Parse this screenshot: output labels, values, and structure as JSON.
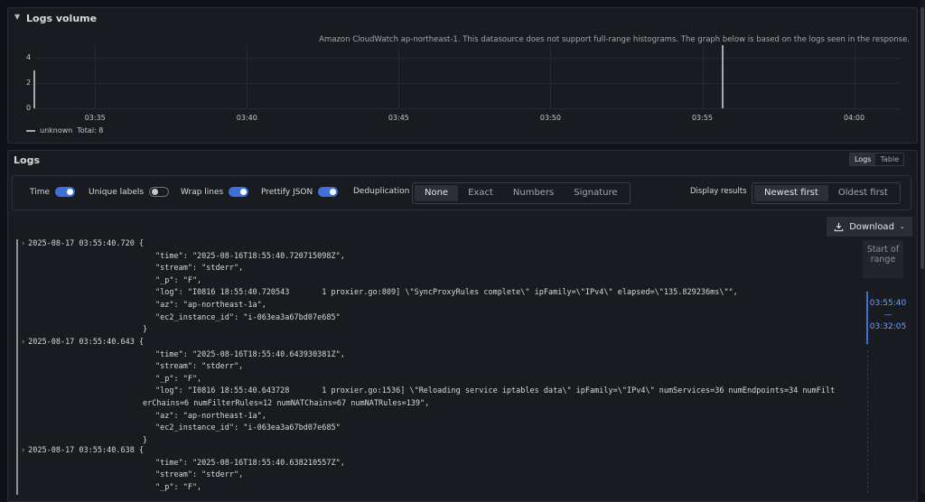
{
  "logs_volume": {
    "title": "Logs volume",
    "info": "Amazon CloudWatch ap-northeast-1. This datasource does not support full-range histograms. The graph below is based on the logs seen in the response.",
    "legend": {
      "series": "unknown",
      "total": "Total: 8"
    }
  },
  "chart_data": {
    "type": "bar",
    "x": [
      "03:33",
      "03:55:40"
    ],
    "values": [
      3,
      5
    ],
    "xticks": [
      "03:35",
      "03:40",
      "03:45",
      "03:50",
      "03:55",
      "04:00"
    ],
    "yticks": [
      "0",
      "2",
      "4"
    ],
    "ylim": [
      0,
      5
    ],
    "series_name": "unknown",
    "grid": true
  },
  "logs": {
    "title": "Logs",
    "view_toggle": [
      "Logs",
      "Table"
    ],
    "options": {
      "time": "Time",
      "unique_labels": "Unique labels",
      "wrap_lines": "Wrap lines",
      "prettify_json": "Prettify JSON",
      "deduplication": "Deduplication",
      "dedup_options": [
        "None",
        "Exact",
        "Numbers",
        "Signature"
      ],
      "display_results": "Display results",
      "order_options": [
        "Newest first",
        "Oldest first"
      ]
    },
    "download": "Download",
    "range": {
      "start": "Start of range",
      "from": "03:55:40",
      "sep": "—",
      "to": "03:32:05"
    },
    "entries": [
      {
        "head": "2025-08-17 03:55:40.720 {",
        "lines": [
          "\"time\": \"2025-08-16T18:55:40.720715098Z\",",
          "\"stream\": \"stderr\",",
          "\"_p\": \"F\",",
          "\"log\": \"I0816 18:55:40.720543       1 proxier.go:809] \\\"SyncProxyRules complete\\\" ipFamily=\\\"IPv4\\\" elapsed=\\\"135.829236ms\\\"\",",
          "\"az\": \"ap-northeast-1a\",",
          "\"ec2_instance_id\": \"i-063ea3a67bd07e685\""
        ],
        "close": "}"
      },
      {
        "head": "2025-08-17 03:55:40.643 {",
        "lines": [
          "\"time\": \"2025-08-16T18:55:40.643930381Z\",",
          "\"stream\": \"stderr\",",
          "\"_p\": \"F\",",
          "\"log\": \"I0816 18:55:40.643728       1 proxier.go:1536] \\\"Reloading service iptables data\\\" ipFamily=\\\"IPv4\\\" numServices=36 numEndpoints=34 numFilt",
          "erChains=6 numFilterRules=12 numNATChains=67 numNATRules=139\",",
          "\"az\": \"ap-northeast-1a\",",
          "\"ec2_instance_id\": \"i-063ea3a67bd07e685\""
        ],
        "close": "}"
      },
      {
        "head": "2025-08-17 03:55:40.638 {",
        "lines": [
          "\"time\": \"2025-08-16T18:55:40.638210557Z\",",
          "\"stream\": \"stderr\",",
          "\"_p\": \"F\","
        ],
        "close": ""
      }
    ]
  }
}
